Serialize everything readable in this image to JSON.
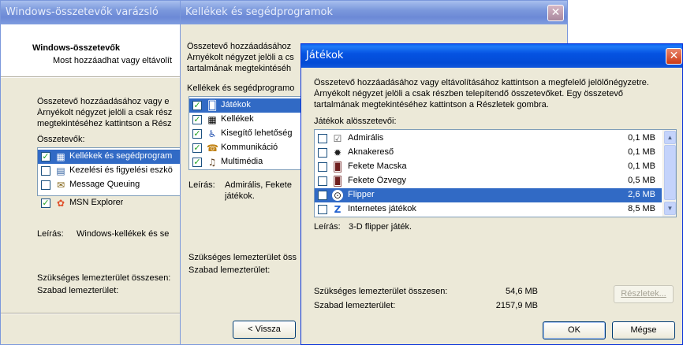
{
  "wizard": {
    "title": "Windows-összetevők varázsló",
    "heading": "Windows-összetevők",
    "subheading": "Most hozzáadhat vagy eltávolít",
    "instr_lines": [
      "Összetevő hozzáadásához vagy e",
      "Árnyékolt négyzet jelöli a csak rész",
      "megtekintéséhez kattintson a Rész"
    ],
    "list_label": "Összetevők:",
    "items": [
      {
        "label": "Kellékek és segédprogram",
        "checked": true,
        "icon": "accessories-icon"
      },
      {
        "label": "Kezelési és figyelési eszkö",
        "checked": false,
        "icon": "management-icon"
      },
      {
        "label": "Message Queuing",
        "checked": false,
        "icon": "message-queuing-icon"
      },
      {
        "label": "MSN Explorer",
        "checked": true,
        "icon": "msn-icon"
      }
    ],
    "desc_label": "Leírás:",
    "desc_text": "Windows-kellékek és se",
    "space_required_label": "Szükséges lemezterület összesen:",
    "space_free_label": "Szabad lemezterület:",
    "back_button": "< Vissza"
  },
  "accessories": {
    "title": "Kellékek és segédprogramok",
    "instr_lines": [
      "Összetevő hozzáadásához",
      "Árnyékolt négyzet jelöli a cs",
      "tartalmának megtekintéséh"
    ],
    "list_label": "Kellékek és segédprogramo",
    "items": [
      {
        "label": "Játékok",
        "checked": true,
        "icon": "games-icon"
      },
      {
        "label": "Kellékek",
        "checked": true,
        "icon": "accessories-icon"
      },
      {
        "label": "Kisegítő lehetőség",
        "checked": true,
        "icon": "accessibility-icon"
      },
      {
        "label": "Kommunikáció",
        "checked": true,
        "icon": "communications-icon"
      },
      {
        "label": "Multimédia",
        "checked": true,
        "icon": "multimedia-icon"
      }
    ],
    "desc_label": "Leírás:",
    "desc_lines": [
      "Admirális, Fekete",
      "játékok."
    ],
    "space_required_label": "Szükséges lemezterület öss",
    "space_free_label": "Szabad lemezterület:"
  },
  "games": {
    "title": "Játékok",
    "instr_lines": [
      "Összetevő hozzáadásához vagy eltávolításához kattintson a megfelelő jelölőnégyzetre.",
      "Árnyékolt négyzet jelöli a csak részben telepítendő összetevőket. Egy összetevő",
      "tartalmának megtekintéséhez kattintson a Részletek gombra."
    ],
    "list_label": "Játékok alösszetevői:",
    "items": [
      {
        "label": "Admirális",
        "size": "0,1 MB",
        "checked": false,
        "selected": false,
        "icon": "admiral-icon"
      },
      {
        "label": "Aknakereső",
        "size": "0,1 MB",
        "checked": false,
        "selected": false,
        "icon": "mine-icon"
      },
      {
        "label": "Fekete Macska",
        "size": "0,1 MB",
        "checked": false,
        "selected": false,
        "icon": "cards-icon"
      },
      {
        "label": "Fekete Özvegy",
        "size": "0,5 MB",
        "checked": false,
        "selected": false,
        "icon": "cards-icon"
      },
      {
        "label": "Flipper",
        "size": "2,6 MB",
        "checked": false,
        "selected": true,
        "icon": "pinball-icon"
      },
      {
        "label": "Internetes játékok",
        "size": "8,5 MB",
        "checked": false,
        "selected": false,
        "icon": "internet-games-icon"
      }
    ],
    "desc_label": "Leírás:",
    "desc_text": "3-D flipper játék.",
    "space_required_label": "Szükséges lemezterület összesen:",
    "space_required_value": "54,6 MB",
    "space_free_label": "Szabad lemezterület:",
    "space_free_value": "2157,9 MB",
    "details_button": "Részletek...",
    "ok_button": "OK",
    "cancel_button": "Mégse"
  },
  "colors": {
    "title_active": "#0553E2",
    "title_inactive": "#7B98DC",
    "selection": "#316AC5",
    "dialog_bg": "#ECE9D8"
  }
}
